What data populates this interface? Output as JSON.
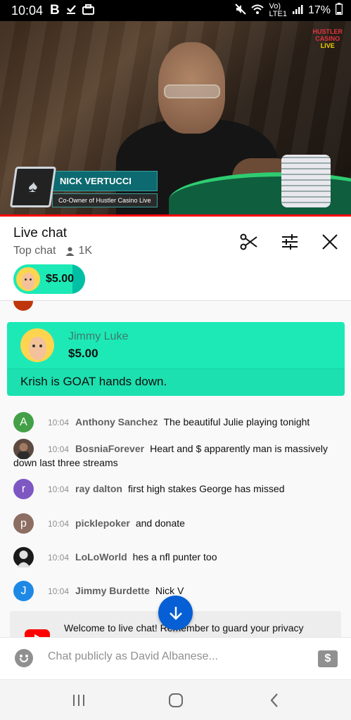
{
  "status_bar": {
    "time": "10:04",
    "left_icons": [
      "b-icon",
      "download-done-icon",
      "briefcase-icon"
    ],
    "right_icons": [
      "mute-icon",
      "wifi-icon",
      "volte-icon",
      "signal-icon"
    ],
    "volte_top": "Vo)",
    "volte_bottom": "LTE1",
    "battery": "17%"
  },
  "video": {
    "channel_logo_line1": "HUSTLER",
    "channel_logo_line2": "CASINO",
    "channel_logo_line3": "LIVE",
    "lower_third_name": "NICK VERTUCCI",
    "lower_third_role": "Co-Owner of Hustler Casino Live",
    "progress_color": "#ff0000"
  },
  "chat_header": {
    "title": "Live chat",
    "mode": "Top chat",
    "viewers": "1K",
    "ticker_amount": "$5.00"
  },
  "superchat": {
    "author": "Jimmy Luke",
    "amount": "$5.00",
    "message": "Krish is GOAT hands down.",
    "color": "#1de9b6"
  },
  "messages": [
    {
      "avatar": "A",
      "avatar_color": "#43a047",
      "time": "10:04",
      "author": "Anthony Sanchez",
      "text": "The beautiful Julie playing tonight"
    },
    {
      "avatar": "",
      "avatar_color": "#5d4a40",
      "time": "10:04",
      "author": "BosniaForever",
      "text": "Heart and $ apparently man is massively down last three streams"
    },
    {
      "avatar": "r",
      "avatar_color": "#7e57c2",
      "time": "10:04",
      "author": "ray dalton",
      "text": "first high stakes George has missed"
    },
    {
      "avatar": "p",
      "avatar_color": "#8d6e63",
      "time": "10:04",
      "author": "picklepoker",
      "text": "and donate"
    },
    {
      "avatar": "",
      "avatar_color": "#1a1a1a",
      "time": "10:04",
      "author": "LoLoWorld",
      "text": "hes a nfl punter too"
    },
    {
      "avatar": "J",
      "avatar_color": "#1e88e5",
      "time": "10:04",
      "author": "Jimmy Burdette",
      "text": "Nick V"
    }
  ],
  "welcome": {
    "text": "Welcome to live chat! Remember to guard your privacy"
  },
  "input": {
    "placeholder": "Chat publicly as David Albanese...",
    "dollar_symbol": "$"
  },
  "nav": {
    "recents_icon": "recents-icon",
    "home_icon": "home-icon",
    "back_icon": "back-icon"
  }
}
